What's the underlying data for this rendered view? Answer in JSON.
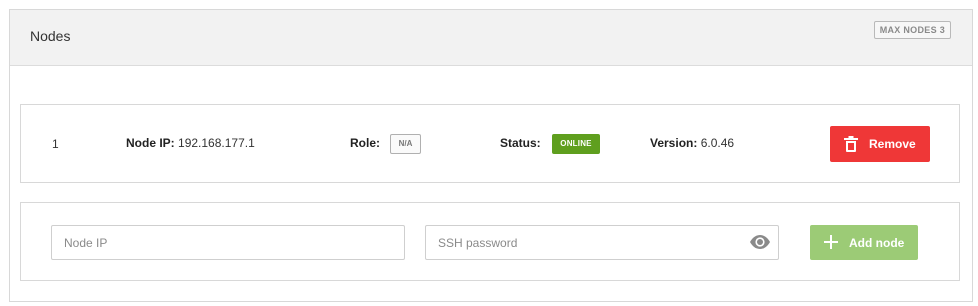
{
  "panel": {
    "title": "Nodes",
    "max_badge": "MAX NODES 3"
  },
  "node": {
    "index": "1",
    "ip_label": "Node IP:",
    "ip_value": "192.168.177.1",
    "role_label": "Role:",
    "role_value": "N/A",
    "status_label": "Status:",
    "status_value": "ONLINE",
    "version_label": "Version:",
    "version_value": "6.0.46",
    "remove_label": "Remove",
    "remove_icon": "trash-icon"
  },
  "add_form": {
    "ip_placeholder": "Node IP",
    "ip_value": "",
    "password_placeholder": "SSH password",
    "password_value": "",
    "eye_icon": "eye-icon",
    "add_label": "Add node",
    "add_icon": "plus-icon"
  },
  "colors": {
    "status_online": "#5f9f1e",
    "remove_button": "#ef3737",
    "add_button": "#9ccb76"
  }
}
